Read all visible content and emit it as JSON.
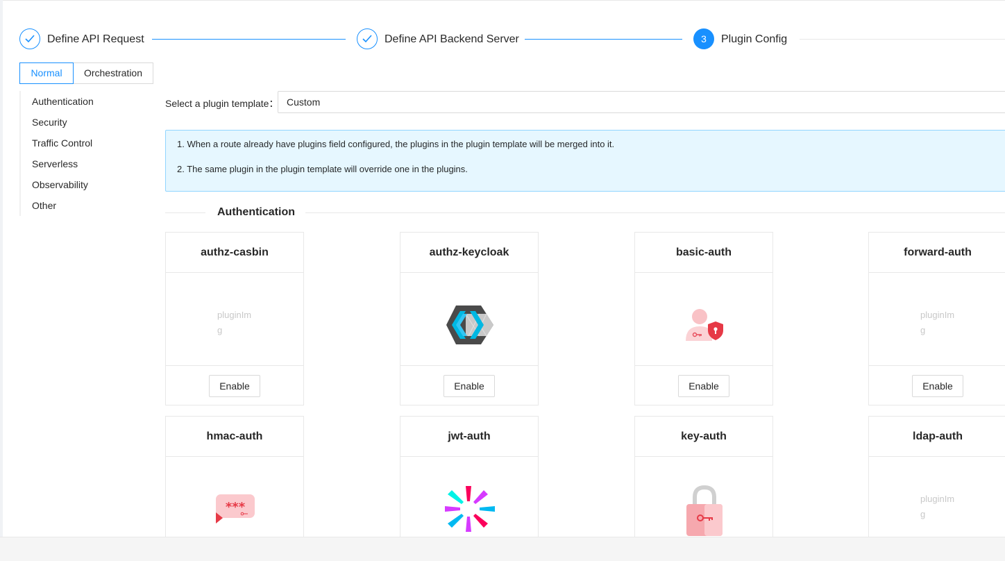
{
  "steps": [
    {
      "title": "Define API Request",
      "status": "finish"
    },
    {
      "title": "Define API Backend Server",
      "status": "finish"
    },
    {
      "number": "3",
      "title": "Plugin Config",
      "status": "process"
    }
  ],
  "mode_tabs": {
    "normal": "Normal",
    "orchestration": "Orchestration",
    "selected": "Normal"
  },
  "categories": [
    "Authentication",
    "Security",
    "Traffic Control",
    "Serverless",
    "Observability",
    "Other"
  ],
  "template": {
    "label": "Select a plugin template：",
    "value": "Custom"
  },
  "notice": {
    "line1": "1. When a route already have plugins field configured, the plugins in the plugin template will be merged into it.",
    "line2": "2. The same plugin in the plugin template will override one in the plugins."
  },
  "section_title": "Authentication",
  "enable_label": "Enable",
  "broken_image_alt": "pluginImg",
  "plugins": [
    {
      "name": "authz-casbin",
      "icon": "broken-image-icon"
    },
    {
      "name": "authz-keycloak",
      "icon": "keycloak-logo-icon"
    },
    {
      "name": "basic-auth",
      "icon": "user-shield-icon"
    },
    {
      "name": "forward-auth",
      "icon": "broken-image-icon"
    },
    {
      "name": "hmac-auth",
      "icon": "password-bubble-icon"
    },
    {
      "name": "jwt-auth",
      "icon": "jwt-logo-icon"
    },
    {
      "name": "key-auth",
      "icon": "padlock-key-icon"
    },
    {
      "name": "ldap-auth",
      "icon": "broken-image-icon"
    }
  ],
  "colors": {
    "primary": "#1890ff",
    "alert_bg": "#e6f7ff",
    "alert_border": "#91d5ff"
  }
}
